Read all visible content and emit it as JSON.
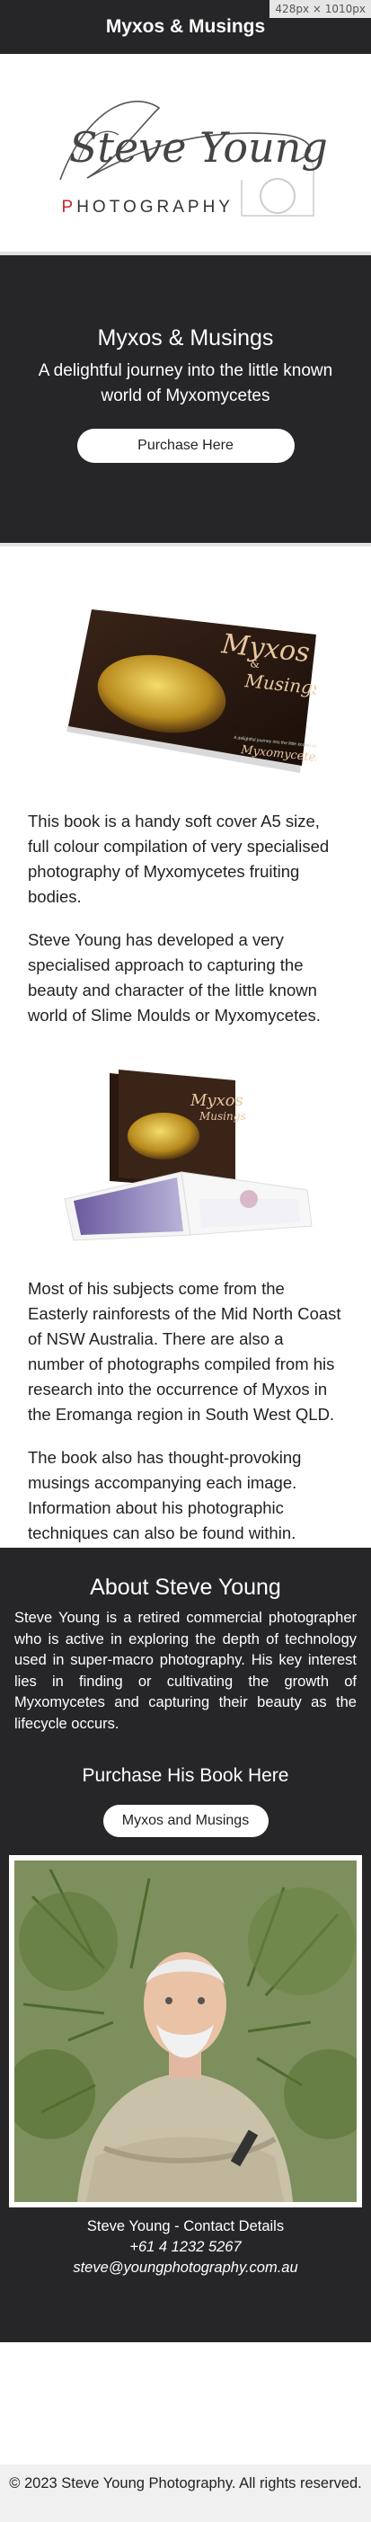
{
  "topbar": {
    "title": "Myxos & Musings",
    "dimension_badge": "428px × 1010px"
  },
  "logo": {
    "script_text": "Steve Young",
    "sub_first_letter": "P",
    "sub_rest": "HOTOGRAPHY"
  },
  "hero": {
    "title": "Myxos & Musings",
    "subtitle": "A delightful journey into the little known world of Myxomycetes",
    "button_label": "Purchase Here"
  },
  "book_cover": {
    "title_line1": "Myxos",
    "title_amp": "&",
    "title_line2": "Musings",
    "tagline": "A delightful journey into the little known world of",
    "tagline_word": "Myxomycetes"
  },
  "open_book": {
    "title_line1": "Myxos",
    "title_line2": "Musings"
  },
  "content": {
    "para1": "This book is a handy soft cover A5 size, full colour compilation of very specialised photography of Myxomycetes fruiting bodies.",
    "para2": "Steve Young has developed a very specialised approach to capturing the beauty and character of the little known world of Slime Moulds or Myxomycetes.",
    "para3": "Most of his subjects come from the Easterly rainforests of the Mid North Coast of NSW Australia. There are also a number of photographs compiled from his research into the occurrence of Myxos in the Eromanga region in South West QLD.",
    "para4": "The book also has thought-provoking musings accompanying each image. Information about his photographic techniques can also be found within."
  },
  "about": {
    "title": "About Steve Young",
    "text": "Steve Young is a retired commercial photographer who is active in exploring the depth of technology used in super-macro photography. His key interest lies in finding or cultivating the growth of Myxomycetes and capturing their beauty as the lifecycle occurs.",
    "buy_title": "Purchase His Book Here",
    "buy_button": "Myxos and Musings"
  },
  "contact": {
    "title": "Steve Young - Contact Details",
    "phone": "+61 4 1232 5267",
    "email": "steve@youngphotography.com.au"
  },
  "footer": {
    "text": "© 2023 Steve Young Photography. All rights reserved."
  }
}
